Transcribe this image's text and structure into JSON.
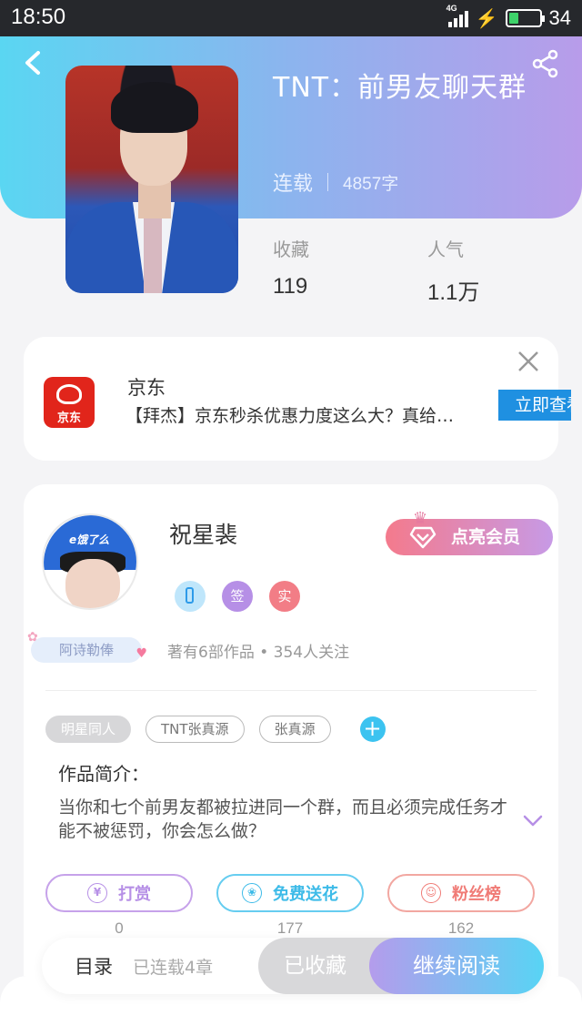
{
  "status_bar": {
    "time": "18:50",
    "network": "4G",
    "battery": "34",
    "battery_level": 0.34
  },
  "book": {
    "title": "TNT：前男友聊天群",
    "status": "连载",
    "word_count": "4857字",
    "stats": [
      {
        "label": "收藏",
        "value": "119"
      },
      {
        "label": "人气",
        "value": "1.1万"
      }
    ]
  },
  "ad": {
    "logo_text": "京东",
    "name": "京东",
    "description": "【拜杰】京东秒杀优惠力度这么大？真给…",
    "cta": "立即查看"
  },
  "author": {
    "name": "祝星裴",
    "badge_name": "阿诗勒俸",
    "vip_button": "点亮会员",
    "verify_icons": [
      "",
      "签",
      "实"
    ],
    "works_info": "著有6部作品 • 354人关注",
    "avatar_text": "e饿了么"
  },
  "tags": [
    "明星同人",
    "TNT张真源",
    "张真源"
  ],
  "tag_add": "+",
  "intro_label": "作品简介：",
  "intro_text": "当你和七个前男友都被拉进同一个群，而且必须完成任务才能不被惩罚，你会怎么做？",
  "actions": [
    {
      "icon": "¥",
      "label": "打赏",
      "count": "0"
    },
    {
      "icon": "❀",
      "label": "免费送花",
      "count": "177"
    },
    {
      "icon": "☺",
      "label": "粉丝榜",
      "count": "162"
    }
  ],
  "bottom_bar": {
    "toc": "目录",
    "progress": "已连载4章",
    "collected": "已收藏",
    "continue": "继续阅读"
  },
  "colors": {
    "header_gradient_start": "#5ad6f2",
    "header_gradient_end": "#b89cea",
    "ad_cta": "#1f90e1",
    "jd_red": "#e1251b"
  }
}
